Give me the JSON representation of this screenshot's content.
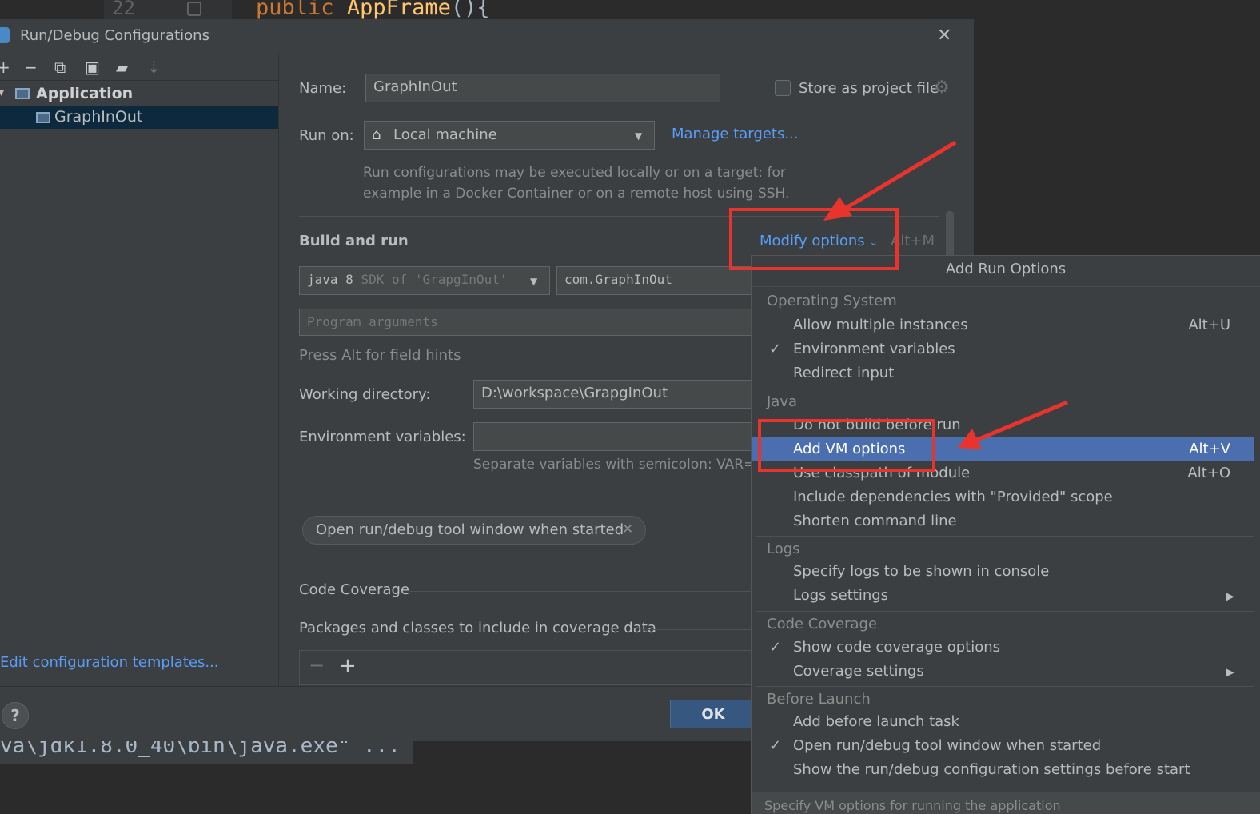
{
  "editor": {
    "line_number": "22",
    "code_keyword": "public",
    "code_method": "AppFrame",
    "code_punct": "(){",
    "console_text": "va\\jdk1.8.0_40\\bin\\java.exe\" ..."
  },
  "dialog": {
    "title": "Run/Debug Configurations",
    "tree": {
      "group": "Application",
      "item": "GraphInOut"
    },
    "edit_templates": "Edit configuration templates...",
    "help": "?",
    "ok": "OK"
  },
  "form": {
    "name_label": "Name:",
    "name_value": "GraphInOut",
    "store_label": "Store as project file",
    "runon_label": "Run on:",
    "runon_value": "Local machine",
    "manage_targets": "Manage targets...",
    "runon_hint_1": "Run configurations may be executed locally or on a target: for",
    "runon_hint_2": "example in a Docker Container or on a remote host using SSH.",
    "build_title": "Build and run",
    "modify_options": "Modify options",
    "modify_shortcut": "Alt+M",
    "sdk_main": "java 8",
    "sdk_sub": "SDK of 'GrapgInOut'",
    "main_class": "com.GraphInOut",
    "program_args_placeholder": "Program arguments",
    "field_hint": "Press Alt for field hints",
    "wd_label": "Working directory:",
    "wd_value": "D:\\workspace\\GrapgInOut",
    "env_label": "Environment variables:",
    "env_hint": "Separate variables with semicolon: VAR=",
    "chip_label": "Open run/debug tool window when started",
    "coverage_title": "Code Coverage",
    "packages_label": "Packages and classes to include in coverage data"
  },
  "popup": {
    "title": "Add Run Options",
    "groups": {
      "os": "Operating System",
      "java": "Java",
      "logs": "Logs",
      "coverage": "Code Coverage",
      "before": "Before Launch"
    },
    "items": {
      "allow_multiple": "Allow multiple instances",
      "allow_multiple_sc": "Alt+U",
      "env_vars": "Environment variables",
      "redirect_input": "Redirect input",
      "do_not_build": "Do not build before run",
      "add_vm": "Add VM options",
      "add_vm_sc": "Alt+V",
      "use_classpath": "Use classpath of module",
      "use_classpath_sc": "Alt+O",
      "include_deps": "Include dependencies with \"Provided\" scope",
      "shorten_cmd": "Shorten command line",
      "specify_logs": "Specify logs to be shown in console",
      "logs_settings": "Logs settings",
      "show_coverage": "Show code coverage options",
      "coverage_settings": "Coverage settings",
      "add_before": "Add before launch task",
      "open_tool_window": "Open run/debug tool window when started",
      "show_settings": "Show the run/debug configuration settings before start"
    },
    "footer": "Specify VM options for running the application"
  },
  "colors": {
    "accent_link": "#589df6",
    "selection": "#4b6eaf",
    "annotation": "#e8342d",
    "ok_button": "#365880"
  }
}
